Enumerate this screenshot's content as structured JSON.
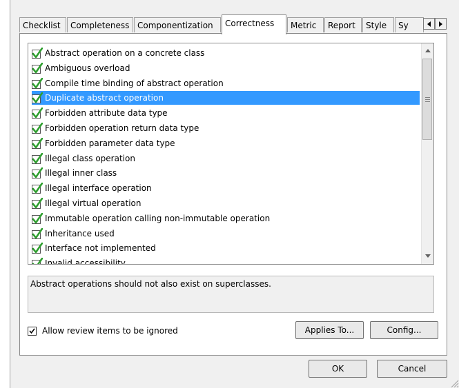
{
  "tabs": [
    {
      "label": "Checklist",
      "active": false
    },
    {
      "label": "Completeness",
      "active": false
    },
    {
      "label": "Componentization",
      "active": false
    },
    {
      "label": "Correctness",
      "active": true
    },
    {
      "label": "Metric",
      "active": false
    },
    {
      "label": "Report",
      "active": false
    },
    {
      "label": "Style",
      "active": false
    },
    {
      "label": "Sy",
      "active": false
    }
  ],
  "tab_scroll": {
    "left_icon": "arrow-left-icon",
    "right_icon": "arrow-right-icon"
  },
  "rules": {
    "selected_index": 3,
    "items": [
      {
        "label": "Abstract operation on a concrete class",
        "checked": true
      },
      {
        "label": "Ambiguous overload",
        "checked": true
      },
      {
        "label": "Compile time binding of abstract operation",
        "checked": true
      },
      {
        "label": "Duplicate abstract operation",
        "checked": true
      },
      {
        "label": "Forbidden attribute data type",
        "checked": true
      },
      {
        "label": "Forbidden operation return data type",
        "checked": true
      },
      {
        "label": "Forbidden parameter data type",
        "checked": true
      },
      {
        "label": "Illegal class operation",
        "checked": true
      },
      {
        "label": "Illegal inner class",
        "checked": true
      },
      {
        "label": "Illegal interface operation",
        "checked": true
      },
      {
        "label": "Illegal virtual operation",
        "checked": true
      },
      {
        "label": "Immutable operation calling non-immutable operation",
        "checked": true
      },
      {
        "label": "Inheritance used",
        "checked": true
      },
      {
        "label": "Interface not implemented",
        "checked": true
      },
      {
        "label": "Invalid accessibility",
        "checked": true
      }
    ]
  },
  "description": "Abstract operations should not also exist on superclasses.",
  "allow_ignore": {
    "label": "Allow review items to be ignored",
    "checked": true
  },
  "buttons": {
    "applies_to": "Applies To...",
    "config": "Config...",
    "ok": "OK",
    "cancel": "Cancel"
  },
  "colors": {
    "selection": "#3399ff",
    "check": "#2e9e2e"
  }
}
